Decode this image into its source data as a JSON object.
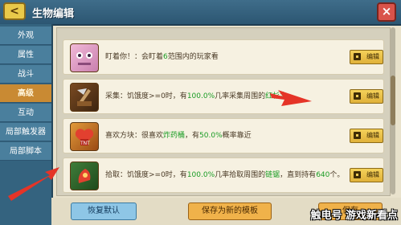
{
  "titlebar": {
    "back_label": "<",
    "title": "生物编辑",
    "close_label": "×"
  },
  "sidebar": {
    "items": [
      {
        "label": "外观"
      },
      {
        "label": "属性"
      },
      {
        "label": "战斗"
      },
      {
        "label": "高级",
        "active": true
      },
      {
        "label": "互动"
      },
      {
        "label": "局部触发器"
      },
      {
        "label": "局部脚本"
      }
    ]
  },
  "rows": [
    {
      "pre": "盯着你！：会盯着",
      "hl": "6",
      "post": "范围内的玩家看",
      "hl2": "",
      "post2": "",
      "edit": "编辑"
    },
    {
      "pre": "采集：饥饿度>=0时，有",
      "hl": "100.0%",
      "post": "几率采集周围的",
      "hl2": "红杉木",
      "post2": "。",
      "edit": "编辑"
    },
    {
      "pre": "喜欢方块：很喜欢",
      "hl": "炸药桶",
      "post": "，有",
      "hl2": "50.0%",
      "post2": "概率靠近",
      "edit": "编辑"
    },
    {
      "pre": "拾取：饥饿度>=0时，有",
      "hl": "100.0%",
      "post": "几率拾取周围的",
      "hl2": "链锯",
      "post2": "，直到持有",
      "hl3": "640",
      "post3": "个。",
      "edit": "编辑"
    }
  ],
  "bottom": {
    "reset_label": "恢复默认",
    "save_template_label": "保存为新的模板",
    "save_label": "保存"
  },
  "watermark": "触电号 游戏新看点",
  "colors": {
    "highlight": "#1a9c24",
    "arrow": "#e53427",
    "accent": "#c98a33"
  }
}
